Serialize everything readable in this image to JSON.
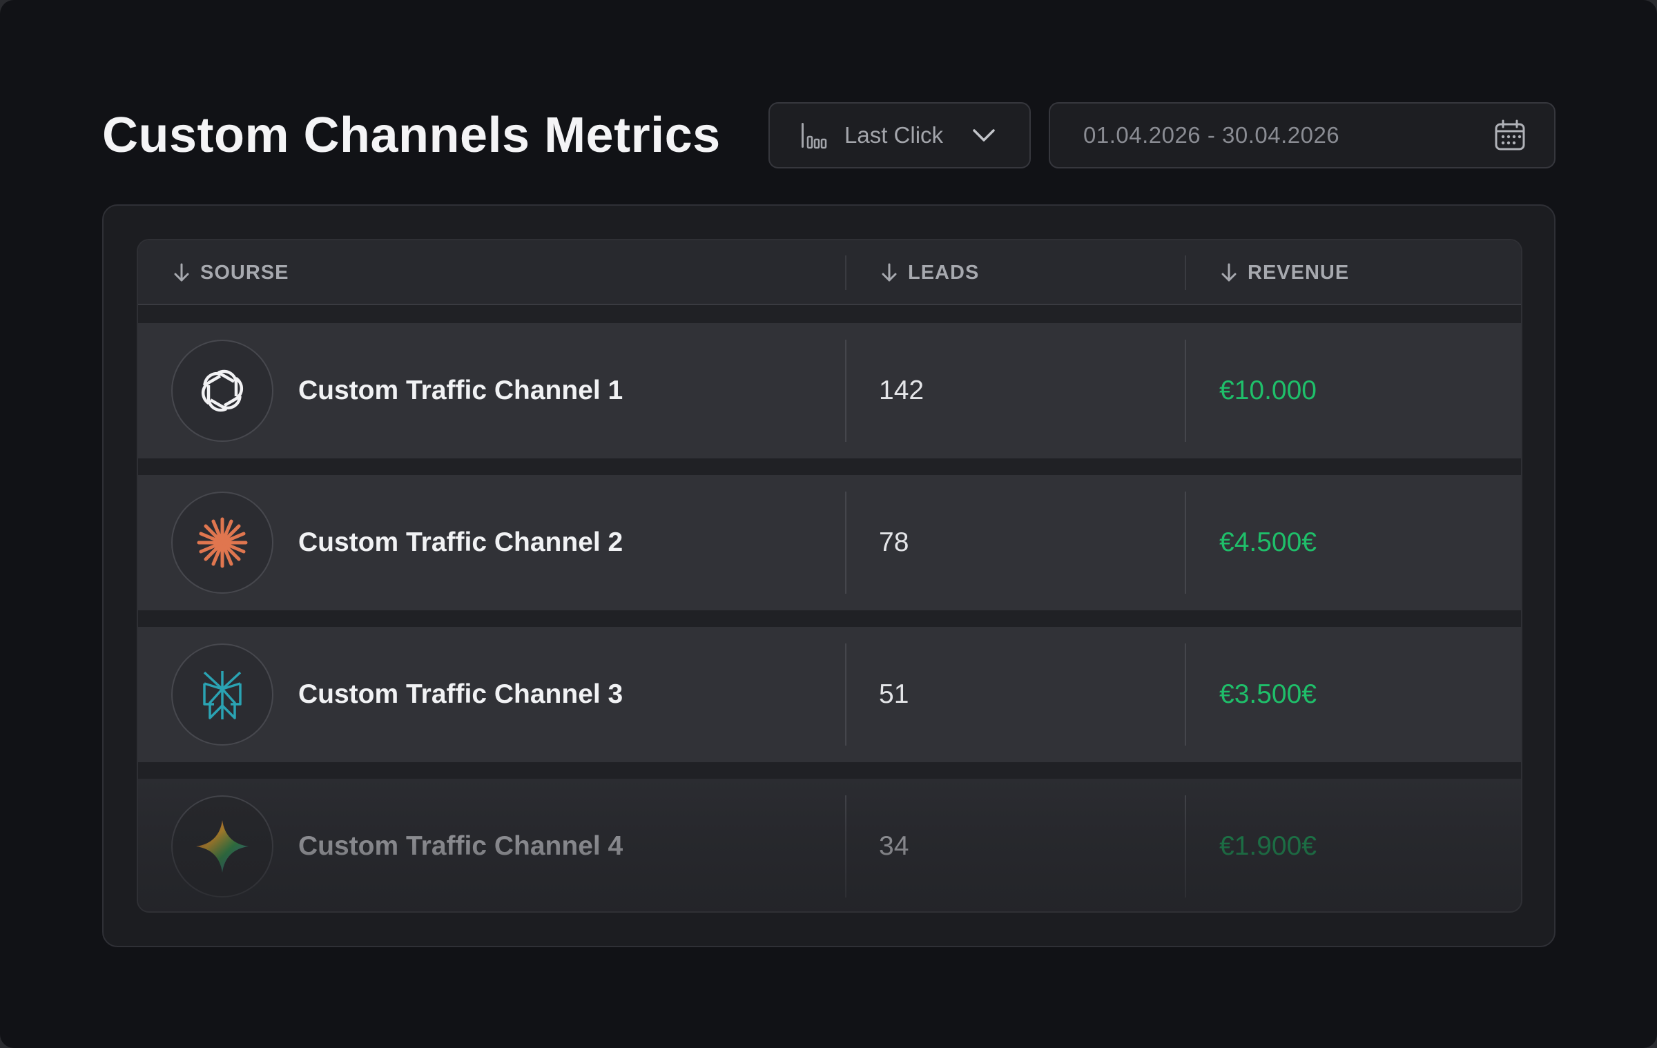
{
  "header": {
    "title": "Custom Channels Metrics",
    "attribution_select": {
      "value": "Last Click",
      "icon": "bar-chart-icon",
      "chevron": "chevron-down-icon"
    },
    "date_range": {
      "value": "01.04.2026 - 30.04.2026",
      "icon": "calendar-icon"
    }
  },
  "table": {
    "columns": [
      {
        "label": "SOURSE",
        "sort_icon": "arrow-down-icon"
      },
      {
        "label": "LEADS",
        "sort_icon": "arrow-down-icon"
      },
      {
        "label": "REVENUE",
        "sort_icon": "arrow-down-icon"
      }
    ],
    "rows": [
      {
        "icon": "openai-logo-icon",
        "source": "Custom Traffic Channel 1",
        "leads": "142",
        "revenue": "€10.000"
      },
      {
        "icon": "claude-starburst-icon",
        "source": "Custom Traffic Channel 2",
        "leads": "78",
        "revenue": "€4.500€"
      },
      {
        "icon": "perplexity-logo-icon",
        "source": "Custom Traffic Channel 3",
        "leads": "51",
        "revenue": "€3.500€"
      },
      {
        "icon": "gemini-sparkle-icon",
        "source": "Custom Traffic Channel 4",
        "leads": "34",
        "revenue": "€1.900€"
      }
    ]
  },
  "colors": {
    "background": "#111216",
    "revenue": "#1fbf6a",
    "row": "#313237",
    "claude_orange": "#e0764f",
    "perplexity_teal": "#2aa3b3"
  }
}
